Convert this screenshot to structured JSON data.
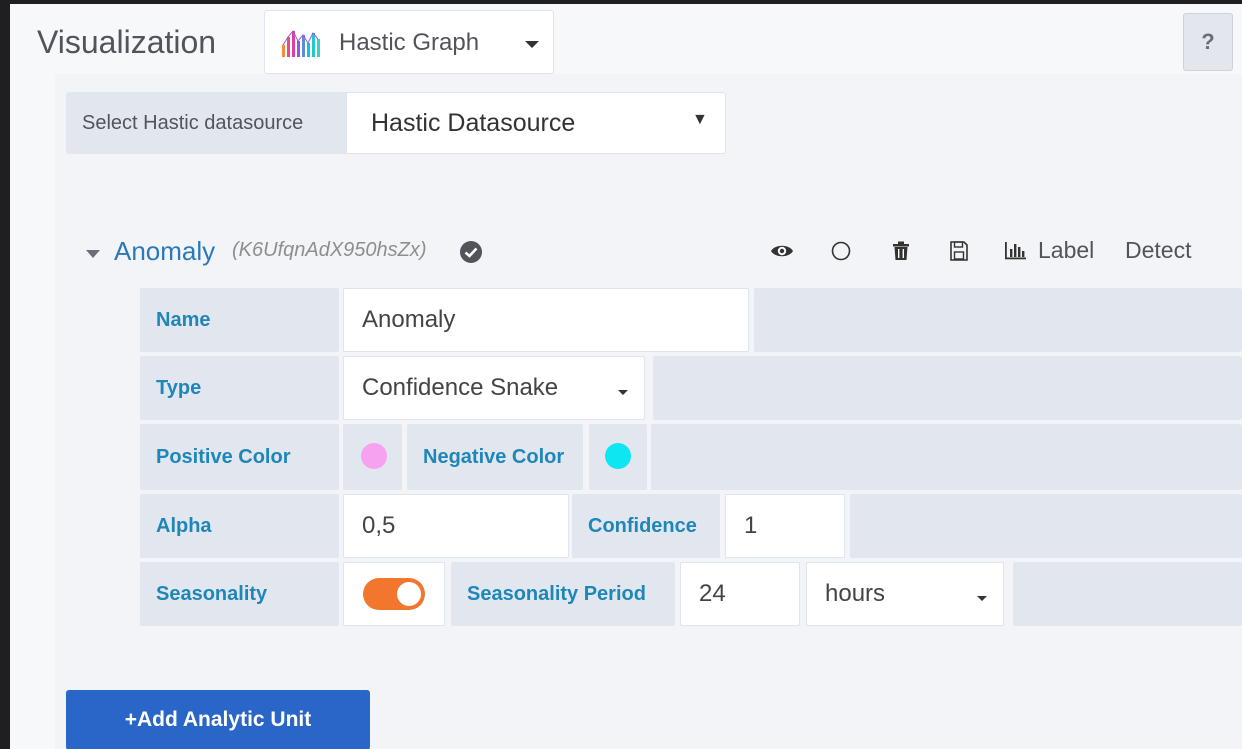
{
  "header": {
    "title": "Visualization",
    "plugin_name": "Hastic Graph",
    "help_label": "?"
  },
  "datasource": {
    "label": "Select Hastic datasource",
    "value": "Hastic Datasource"
  },
  "unit": {
    "name": "Anomaly",
    "id": "(K6UfqnAdX950hsZx)",
    "toolbar": {
      "label_text": "Label",
      "detect_text": "Detect"
    },
    "fields": {
      "name_label": "Name",
      "name_value": "Anomaly",
      "type_label": "Type",
      "type_value": "Confidence Snake",
      "positive_color_label": "Positive Color",
      "positive_color": "#f7a2f1",
      "negative_color_label": "Negative Color",
      "negative_color": "#0ee6f2",
      "alpha_label": "Alpha",
      "alpha_value": "0,5",
      "confidence_label": "Confidence",
      "confidence_value": "1",
      "seasonality_label": "Seasonality",
      "seasonality_enabled": true,
      "seasonality_period_label": "Seasonality Period",
      "seasonality_period_value": "24",
      "seasonality_unit": "hours"
    }
  },
  "add_button": {
    "label": "+Add Analytic Unit"
  },
  "colors": {
    "accent_blue": "#2966c8",
    "label_text": "#1f86b8",
    "toggle_on": "#f2762e"
  }
}
